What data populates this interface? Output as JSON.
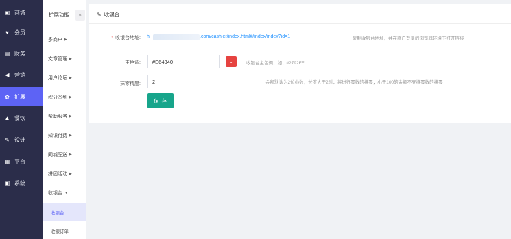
{
  "sidebar": {
    "items": [
      {
        "label": "商城",
        "icon": "store-icon"
      },
      {
        "label": "会员",
        "icon": "member-icon"
      },
      {
        "label": "财务",
        "icon": "finance-icon"
      },
      {
        "label": "营销",
        "icon": "megaphone-icon"
      },
      {
        "label": "扩展",
        "icon": "extension-icon"
      },
      {
        "label": "餐饮",
        "icon": "cake-icon"
      },
      {
        "label": "设计",
        "icon": "brush-icon"
      },
      {
        "label": "平台",
        "icon": "grid-icon"
      },
      {
        "label": "系统",
        "icon": "system-icon"
      }
    ]
  },
  "subnav": {
    "header": "扩展功能",
    "collapse": "«",
    "items": [
      "多商户",
      "文章管理",
      "用户论坛",
      "积分签到",
      "帮助服务",
      "知识付费",
      "同城配送",
      "拼团活动"
    ],
    "open_group": "收银台",
    "children": [
      "收银台",
      "收银订单"
    ]
  },
  "page": {
    "title": "收银台",
    "url_label": "收银台地址:",
    "url_prefix": "h",
    "url_value": ".com/cashier/index.html#/index/index?id=1",
    "url_hint": "复制收银台地址，并在商户登录的浏览器环境下打开链接",
    "color_label": "主色调:",
    "color_value": "#E64340",
    "color_hint": "收银台主色调，如：#2792FF",
    "wipe_label": "抹零精度:",
    "wipe_value": "2",
    "wipe_hint": "金额默认为2位小数，长度大于2时，将进行零数的抹零；小于100的金额不支持零数的抹零",
    "save_label": "保 存"
  },
  "colors": {
    "sidebar": "#2b2d4a",
    "active": "#5d63f5",
    "primary_color": "#E64340",
    "save": "#17a58b"
  }
}
